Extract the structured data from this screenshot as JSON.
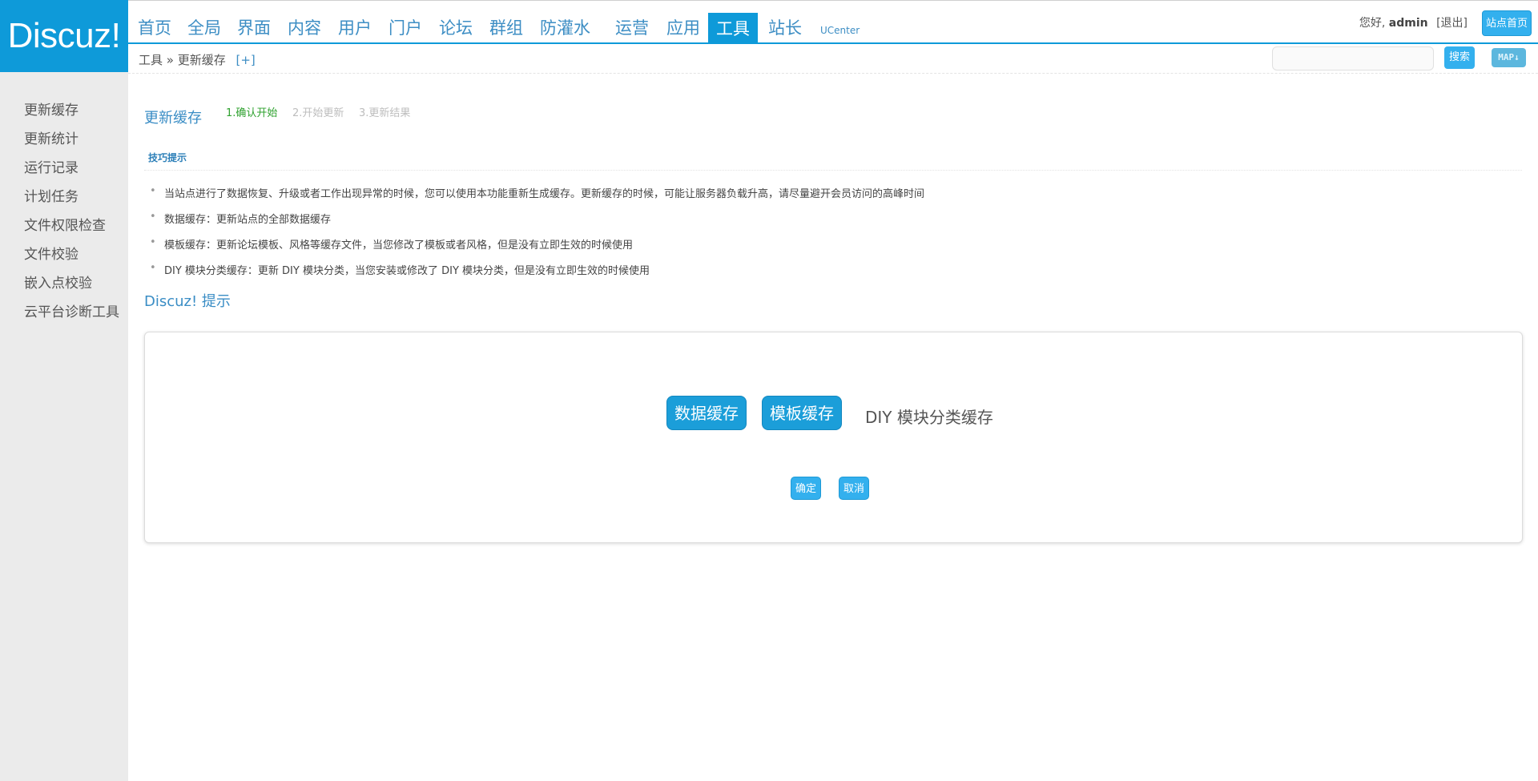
{
  "logo": "Discuz!",
  "nav": {
    "items": [
      "首页",
      "全局",
      "界面",
      "内容",
      "用户",
      "门户",
      "论坛",
      "群组",
      "防灌水",
      "运营",
      "应用",
      "工具",
      "站长",
      "UCenter"
    ],
    "active": "工具"
  },
  "header": {
    "greeting": "您好,",
    "username": "admin",
    "logout": "[退出]",
    "home_button": "站点首页",
    "search_button": "搜索",
    "map_button": "MAP↓"
  },
  "breadcrumb": {
    "text": "工具 » 更新缓存",
    "plus": "[+]"
  },
  "sidebar": {
    "items": [
      "更新缓存",
      "更新统计",
      "运行记录",
      "计划任务",
      "文件权限检查",
      "文件校验",
      "嵌入点校验",
      "云平台诊断工具"
    ]
  },
  "main": {
    "title": "更新缓存",
    "steps": [
      "1.确认开始",
      "2.开始更新",
      "3.更新结果"
    ],
    "tips_title": "技巧提示",
    "tips": [
      "当站点进行了数据恢复、升级或者工作出现异常的时候，您可以使用本功能重新生成缓存。更新缓存的时候，可能让服务器负载升高，请尽量避开会员访问的高峰时间",
      "数据缓存：更新站点的全部数据缓存",
      "模板缓存：更新论坛模板、风格等缓存文件，当您修改了模板或者风格，但是没有立即生效的时候使用",
      "DIY 模块分类缓存：更新 DIY 模块分类，当您安装或修改了 DIY 模块分类，但是没有立即生效的时候使用"
    ],
    "notice_title": "Discuz! 提示",
    "options": {
      "data_cache": "数据缓存",
      "template_cache": "模板缓存",
      "diy_cache": "DIY 模块分类缓存"
    },
    "confirm": "确定",
    "cancel": "取消"
  },
  "colors": {
    "brand": "#0e9ad9",
    "step_current": "#2ea12e",
    "sidebar_bg": "#ebebeb"
  }
}
